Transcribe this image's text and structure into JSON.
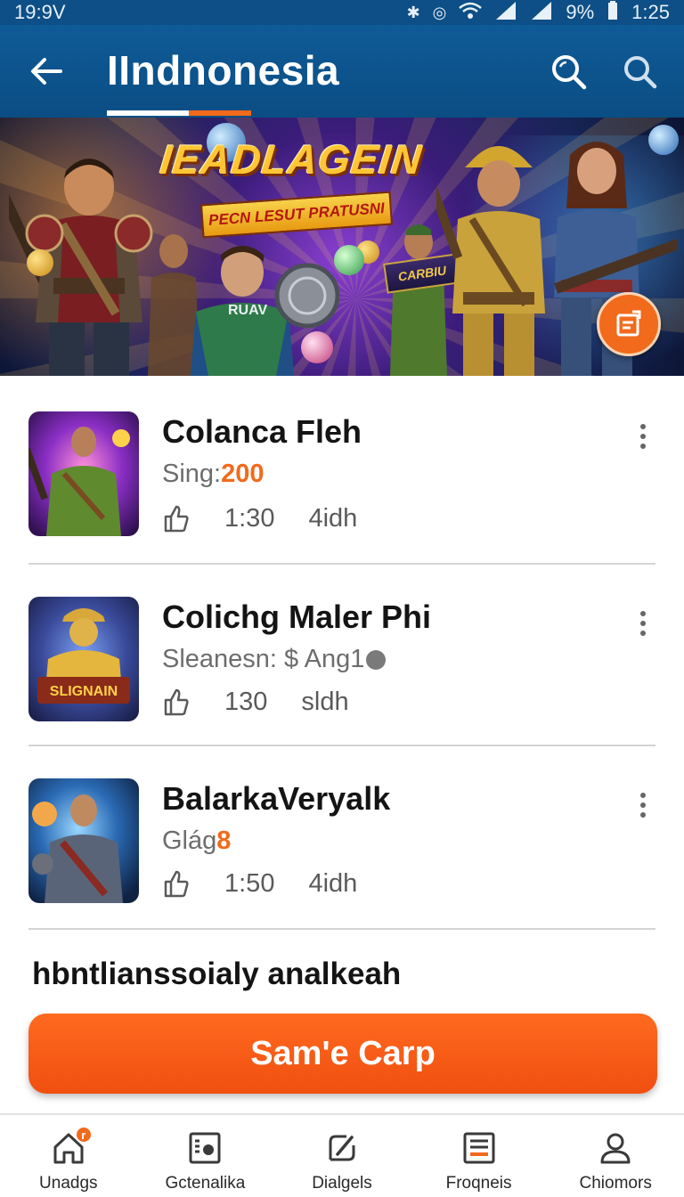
{
  "status_bar": {
    "left_text": "19:9V",
    "battery": "9%",
    "time": "1:25"
  },
  "header": {
    "title": "IIndnonesia",
    "icons": [
      "back-arrow-icon",
      "search-icon",
      "search-icon"
    ]
  },
  "banner": {
    "title": "IEADLAGEIN",
    "ribbon": "PECN LESUT PRATUSNI",
    "sign_text": "CARBIU",
    "jersey_text": "RUAV",
    "fab_icon": "document-icon",
    "accent": "#f26a1b"
  },
  "games": [
    {
      "title": "Colanca Fleh",
      "sub_prefix": "Sing:",
      "sub_accent": "200",
      "meta_1": "1:30",
      "meta_2": "4idh"
    },
    {
      "title": "Colichg Maler Phi",
      "sub_prefix": "Sleanesn: $ Ang1",
      "sub_accent": "",
      "meta_1": "130",
      "meta_2": "sldh"
    },
    {
      "title": "BalarkaVeryalk",
      "sub_prefix": "Glág",
      "sub_accent": "8",
      "meta_1": "1:50",
      "meta_2": "4idh"
    }
  ],
  "section_heading": "hbntlianssoialy analkeah",
  "cta_label": "Sam'e Carp",
  "bottom_nav": [
    {
      "label": "Unadgs",
      "icon": "home-icon",
      "badge": "r"
    },
    {
      "label": "Gctenalika",
      "icon": "gallery-icon"
    },
    {
      "label": "Dialgels",
      "icon": "edit-icon"
    },
    {
      "label": "Froqneis",
      "icon": "list-icon"
    },
    {
      "label": "Chiomors",
      "icon": "profile-icon"
    }
  ],
  "colors": {
    "header_bg": "#0d4f86",
    "accent_orange": "#f26a1b"
  }
}
